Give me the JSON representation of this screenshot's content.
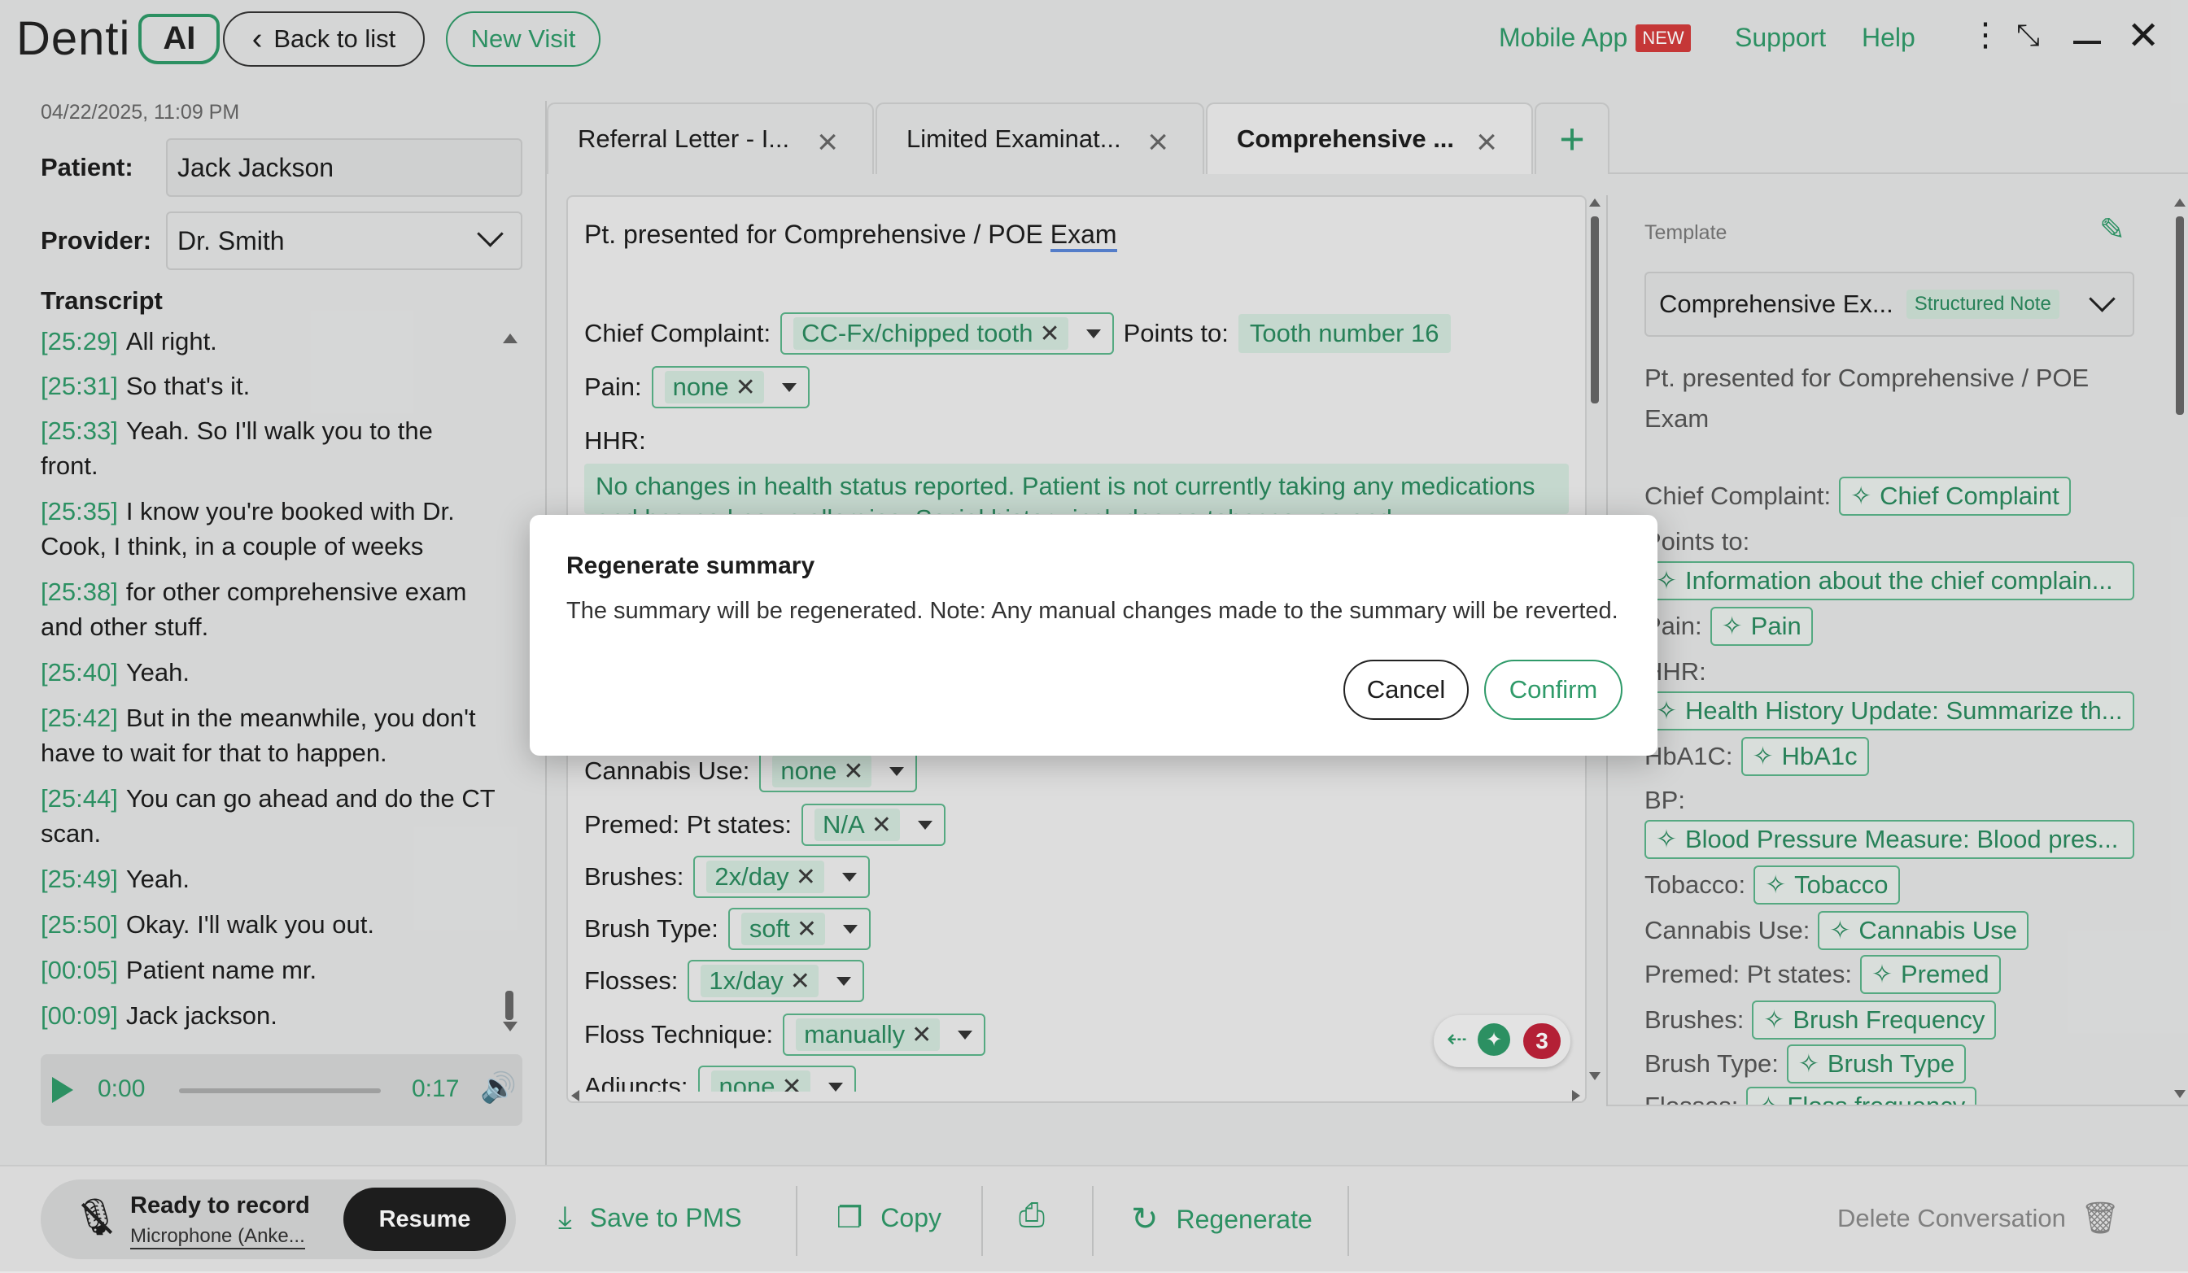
{
  "header": {
    "logo_text": "Denti",
    "logo_badge": "AI",
    "back_label": "Back to list",
    "new_visit_label": "New Visit",
    "mobile_app_label": "Mobile App",
    "new_badge": "NEW",
    "support_label": "Support",
    "help_label": "Help"
  },
  "left": {
    "datetime": "04/22/2025, 11:09 PM",
    "patient_label": "Patient:",
    "patient_value": "Jack Jackson",
    "provider_label": "Provider:",
    "provider_value": "Dr. Smith",
    "transcript_title": "Transcript",
    "transcript": [
      {
        "ts": "[25:29]",
        "text": "All right."
      },
      {
        "ts": "[25:31]",
        "text": "So that's it."
      },
      {
        "ts": "[25:33]",
        "text": "Yeah. So I'll walk you to the front."
      },
      {
        "ts": "[25:35]",
        "text": "I know you're booked with Dr. Cook, I think, in a couple of weeks"
      },
      {
        "ts": "[25:38]",
        "text": "for other comprehensive exam and other stuff."
      },
      {
        "ts": "[25:40]",
        "text": "Yeah."
      },
      {
        "ts": "[25:42]",
        "text": "But in the meanwhile, you don't have to wait for that to happen."
      },
      {
        "ts": "[25:44]",
        "text": "You can go ahead and do the CT scan."
      },
      {
        "ts": "[25:49]",
        "text": "Yeah."
      },
      {
        "ts": "[25:50]",
        "text": "Okay. I'll walk you out."
      },
      {
        "ts": "[00:05]",
        "text": "Patient name mr."
      },
      {
        "ts": "[00:09]",
        "text": "Jack jackson."
      }
    ],
    "audio_current": "0:00",
    "audio_total": "0:17",
    "audio_progress": 0
  },
  "tabs": [
    {
      "label": "Referral Letter - I..."
    },
    {
      "label": "Limited Examinat..."
    },
    {
      "label": "Comprehensive ..."
    }
  ],
  "note": {
    "heading_pre": "Pt. presented for Comprehensive / POE ",
    "heading_exam": "Exam",
    "chief_label": "Chief Complaint:",
    "chief_value": "CC-Fx/chipped tooth",
    "points_label": "Points to:",
    "points_value": "Tooth number 16",
    "pain_label": "Pain:",
    "pain_value": "none",
    "hhr_label": "HHR:",
    "hhr_text": "No changes in health status reported. Patient is not currently taking any medications and has no known allergies. Social history includes no tobacco use and",
    "cannabis_label": "Cannabis Use:",
    "cannabis_value": "none",
    "premed_label": "Premed: Pt states:",
    "premed_value": "N/A",
    "brushes_label": "Brushes:",
    "brushes_value": "2x/day",
    "brush_type_label": "Brush Type:",
    "brush_type_value": "soft",
    "flosses_label": "Flosses:",
    "flosses_value": "1x/day",
    "floss_tech_label": "Floss Technique:",
    "floss_tech_value": "manually",
    "adjuncts_label": "Adjuncts:",
    "adjuncts_value": "none",
    "suggestion_count": "3"
  },
  "template": {
    "label": "Template",
    "select_value": "Comprehensive Ex...",
    "structured_badge": "Structured Note",
    "intro": "Pt. presented for Comprehensive / POE Exam",
    "rows": {
      "chief_label": "Chief Complaint:",
      "chief_tag": "Chief Complaint",
      "points_label": "Points to:",
      "points_tag": "Information about the chief complain...",
      "pain_label": "Pain:",
      "pain_tag": "Pain",
      "hhr_label": "HHR:",
      "hhr_tag": "Health History Update: Summarize th...",
      "hba1c_label": "HbA1C:",
      "hba1c_tag": "HbA1c",
      "bp_label": "BP:",
      "bp_tag": "Blood Pressure Measure: Blood pres...",
      "tobacco_label": "Tobacco:",
      "tobacco_tag": "Tobacco",
      "cannabis_label": "Cannabis Use:",
      "cannabis_tag": "Cannabis Use",
      "premed_label": "Premed: Pt states:",
      "premed_tag": "Premed",
      "brushes_label": "Brushes:",
      "brushes_tag": "Brush Frequency",
      "brush_type_label": "Brush Type:",
      "brush_type_tag": "Brush Type",
      "flosses_label": "Flosses:",
      "flosses_tag": "Floss frequency"
    }
  },
  "dialog": {
    "title": "Regenerate summary",
    "message": "The summary will be regenerated. Note: Any manual changes made to the summary will be reverted.",
    "cancel_label": "Cancel",
    "confirm_label": "Confirm"
  },
  "footer": {
    "record_status": "Ready to record",
    "microphone": "Microphone (Anke...",
    "resume_label": "Resume",
    "save_label": "Save to PMS",
    "copy_label": "Copy",
    "regenerate_label": "Regenerate",
    "delete_label": "Delete Conversation"
  },
  "colors": {
    "accent": "#2f9a69",
    "badge_red": "#d23b3b",
    "dark": "#1f1f1f"
  }
}
